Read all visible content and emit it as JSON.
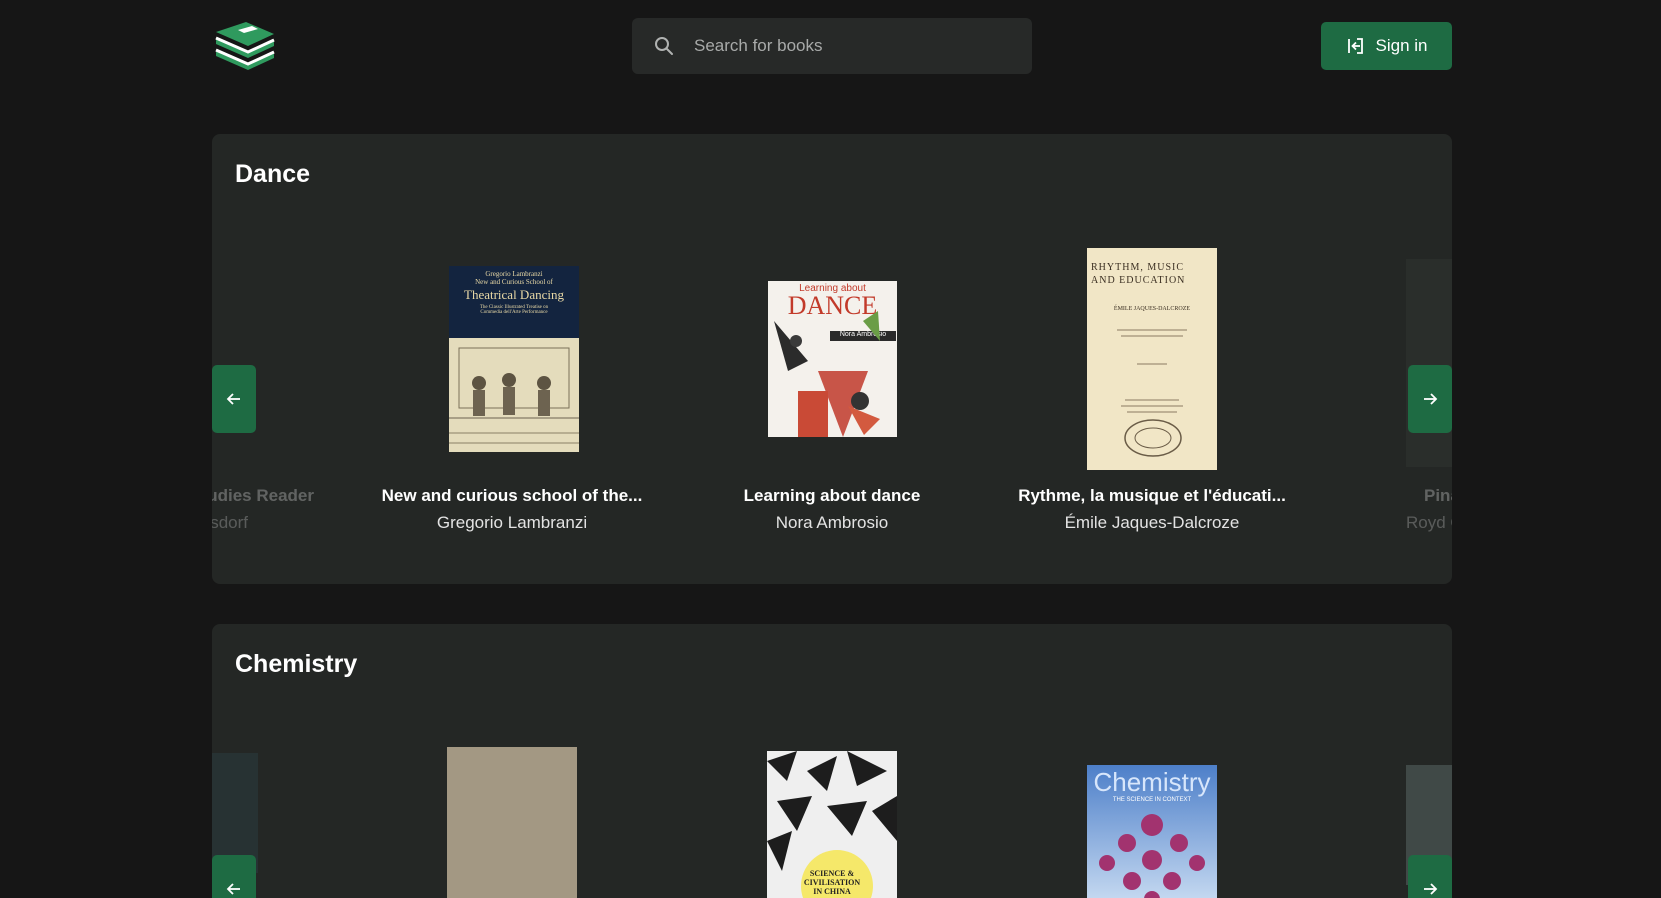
{
  "header": {
    "logo": "stacked-books-logo",
    "search_placeholder": "Search for books",
    "signin_label": "Sign in"
  },
  "colors": {
    "background": "#161616",
    "panel": "#242725",
    "accent": "#1e6b43",
    "search_bg": "#272928"
  },
  "sections": [
    {
      "title": "Dance",
      "partial_left": {
        "title": "tudies Reader",
        "author": "sdorf"
      },
      "books": [
        {
          "title": "New and curious school of the...",
          "author": "Gregorio Lambranzi",
          "cover_text": [
            "Gregorio Lambranzi",
            "New and Curious School of",
            "Theatrical Dancing",
            "The Classic Illustrated Treatise on",
            "Commedia dell'Arte Performance"
          ]
        },
        {
          "title": "Learning about dance",
          "author": "Nora Ambrosio",
          "cover_text": [
            "Learning about",
            "DANCE",
            "Nora Ambrosio"
          ]
        },
        {
          "title": "Rythme, la musique et l'éducati...",
          "author": "Émile Jaques-Dalcroze",
          "cover_text": [
            "RHYTHM, MUSIC",
            "AND EDUCATION",
            "ÉMILE JAQUES-DALCROZE"
          ]
        }
      ],
      "partial_right": {
        "title": "Pina",
        "author": "Royd C"
      }
    },
    {
      "title": "Chemistry",
      "books": [
        {
          "cover_text": []
        },
        {
          "cover_text": [
            "SCIENCE &",
            "CIVILISATION",
            "IN CHINA"
          ]
        },
        {
          "cover_text": [
            "Chemistry",
            "THE SCIENCE IN CONTEXT"
          ]
        }
      ]
    }
  ]
}
